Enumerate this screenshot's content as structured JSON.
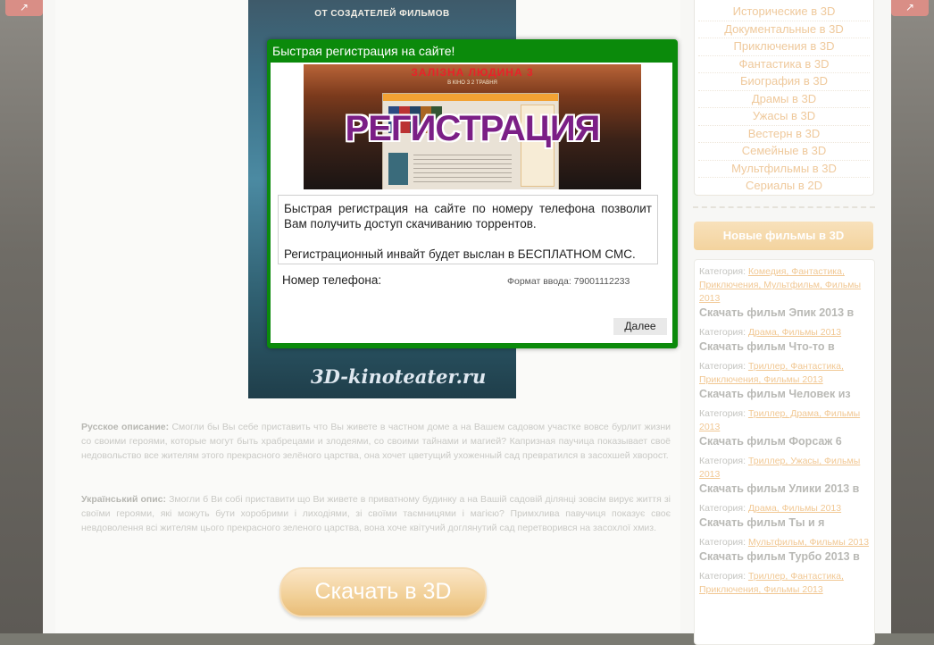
{
  "page": {
    "poster": {
      "top_text": "ОТ СОЗДАТЕЛЕЙ ФИЛЬМОВ",
      "watermark": "3D-kinoteater.ru"
    },
    "description_ru_label": "Русское описание:",
    "description_ru": "Смогли бы Вы себе приставить что Вы живете в частном доме а на Вашем садовом участке вовсе бурлит жизни со своими героями, которые могут быть храбрецами и злодеями, со своими тайнами и магией? Капризная паучица показывает своё недовольство все жителям этого прекрасного зелёного царства, она хочет цветущий ухоженный сад превратился в засохшей хворост.",
    "description_ua_label": "Український опис:",
    "description_ua": "Змогли б Ви собі приставити що Ви живете в приватному будинку а на Вашій садовій ділянці зовсім вирує життя зі своїми героями, які можуть бути хоробрими і лиходіями, зі своїми таємницями і магією? Примхлива павучиця показує своє невдоволення всі жителям цього прекрасного зеленого царства, вона хоче квітучий доглянутий сад перетворився на засохлої хмиз.",
    "download_button": "Скачать в 3D"
  },
  "sidebar": {
    "categories": [
      "Исторические в 3D",
      "Документальные в 3D",
      "Приключения в 3D",
      "Фантастика в 3D",
      "Биография в 3D",
      "Драмы в 3D",
      "Ужасы в 3D",
      "Вестерн в 3D",
      "Семейные в 3D",
      "Мультфильмы в 3D",
      "Сериалы в 2D"
    ],
    "new_films_header": "Новые фильмы в 3D",
    "category_prefix": "Категория:",
    "films": [
      {
        "category": "Комедия, Фантастика, Приключения, Мультфильм, Фильмы 2013",
        "title": "Скачать фильм Эпик 2013 в"
      },
      {
        "category": "Драма, Фильмы 2013",
        "title": "Скачать фильм Что-то в"
      },
      {
        "category": "Триллер, Фантастика, Приключения, Фильмы 2013",
        "title": "Скачать фильм Человек из"
      },
      {
        "category": "Триллер, Драма, Фильмы 2013",
        "title": "Скачать фильм Форсаж 6"
      },
      {
        "category": "Триллер, Ужасы, Фильмы 2013",
        "title": "Скачать фильм Улики 2013 в"
      },
      {
        "category": "Драма, Фильмы 2013",
        "title": "Скачать фильм Ты и я"
      },
      {
        "category": "Мультфильм, Фильмы 2013",
        "title": "Скачать фильм Турбо 2013 в"
      },
      {
        "category": "Триллер, Фантастика, Приключения, Фильмы 2013",
        "title": ""
      }
    ]
  },
  "modal": {
    "title": "Быстрая регистрация на сайте!",
    "banner": {
      "top_text": "ЗАЛІЗНА ЛЮДИНА 3",
      "sub_text": "В КІНО З 2 ТРАВНЯ",
      "word": "РЕГИСТРАЦИЯ"
    },
    "info_text_1": "Быстрая регистрация на сайте по номеру телефона позволит Вам получить доступ скачиванию торрентов.",
    "info_text_2": "Регистрационный инвайт будет выслан в БЕСПЛАТНОМ СМС.",
    "phone_label": "Номер телефона:",
    "phone_value": "",
    "phone_format": "Формат ввода: 79001112233",
    "next_button": "Далее"
  },
  "colors": {
    "modal_border": "#0b8a0b",
    "sidebar_link": "#efc99c",
    "button_gradient_top": "#fbe6c7",
    "button_gradient_bottom": "#e9bd78"
  }
}
